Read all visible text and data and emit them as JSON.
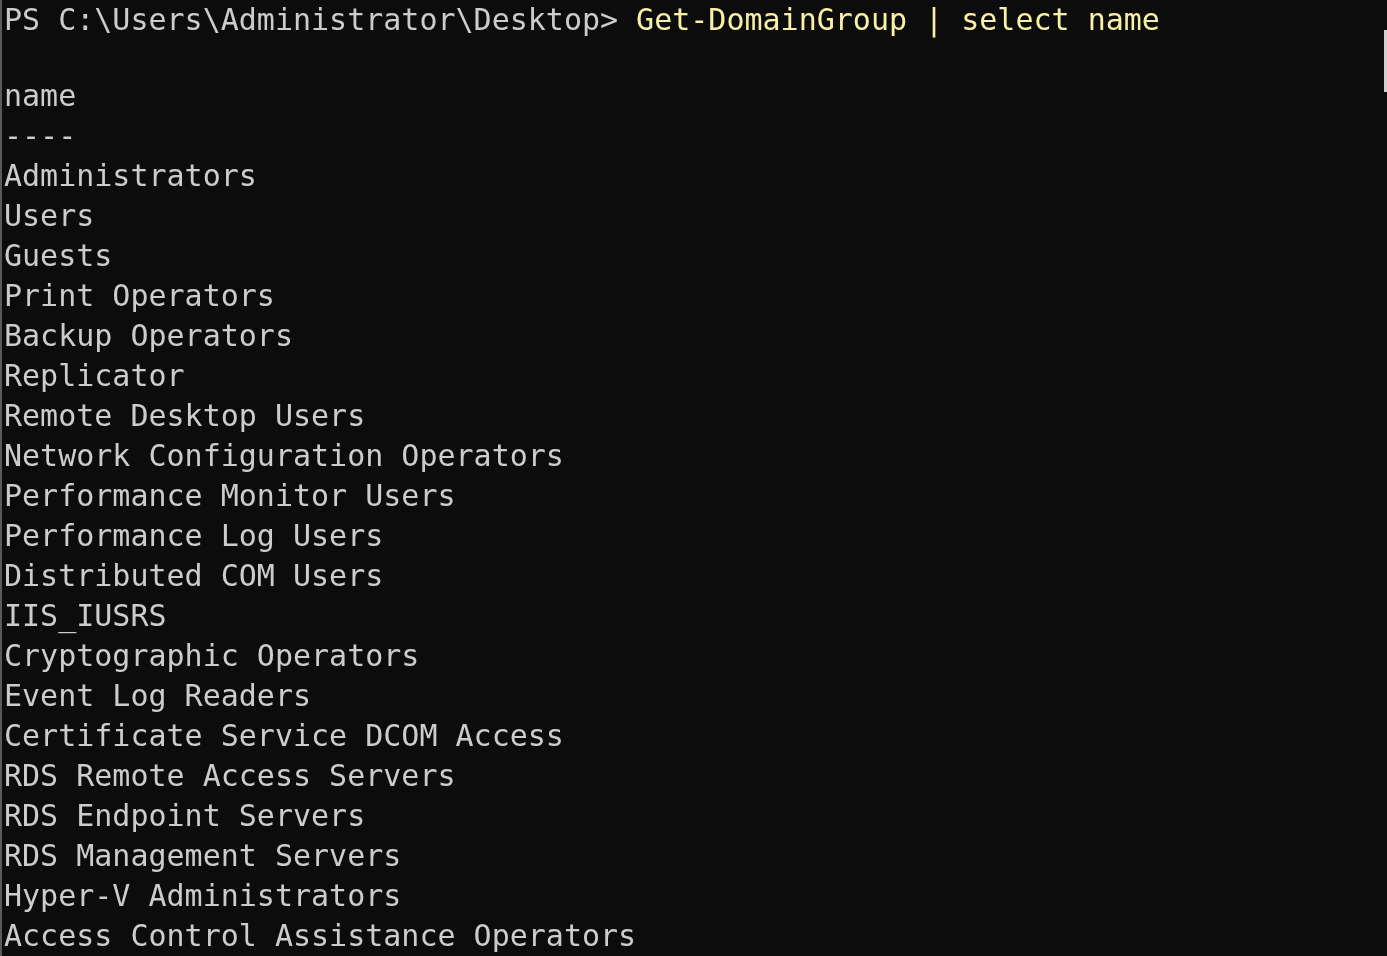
{
  "prompt": "PS C:\\Users\\Administrator\\Desktop>",
  "command": "Get-DomainGroup | select name",
  "output": {
    "header": "name",
    "separator": "----",
    "rows": [
      "Administrators",
      "Users",
      "Guests",
      "Print Operators",
      "Backup Operators",
      "Replicator",
      "Remote Desktop Users",
      "Network Configuration Operators",
      "Performance Monitor Users",
      "Performance Log Users",
      "Distributed COM Users",
      "IIS_IUSRS",
      "Cryptographic Operators",
      "Event Log Readers",
      "Certificate Service DCOM Access",
      "RDS Remote Access Servers",
      "RDS Endpoint Servers",
      "RDS Management Servers",
      "Hyper-V Administrators",
      "Access Control Assistance Operators"
    ]
  }
}
